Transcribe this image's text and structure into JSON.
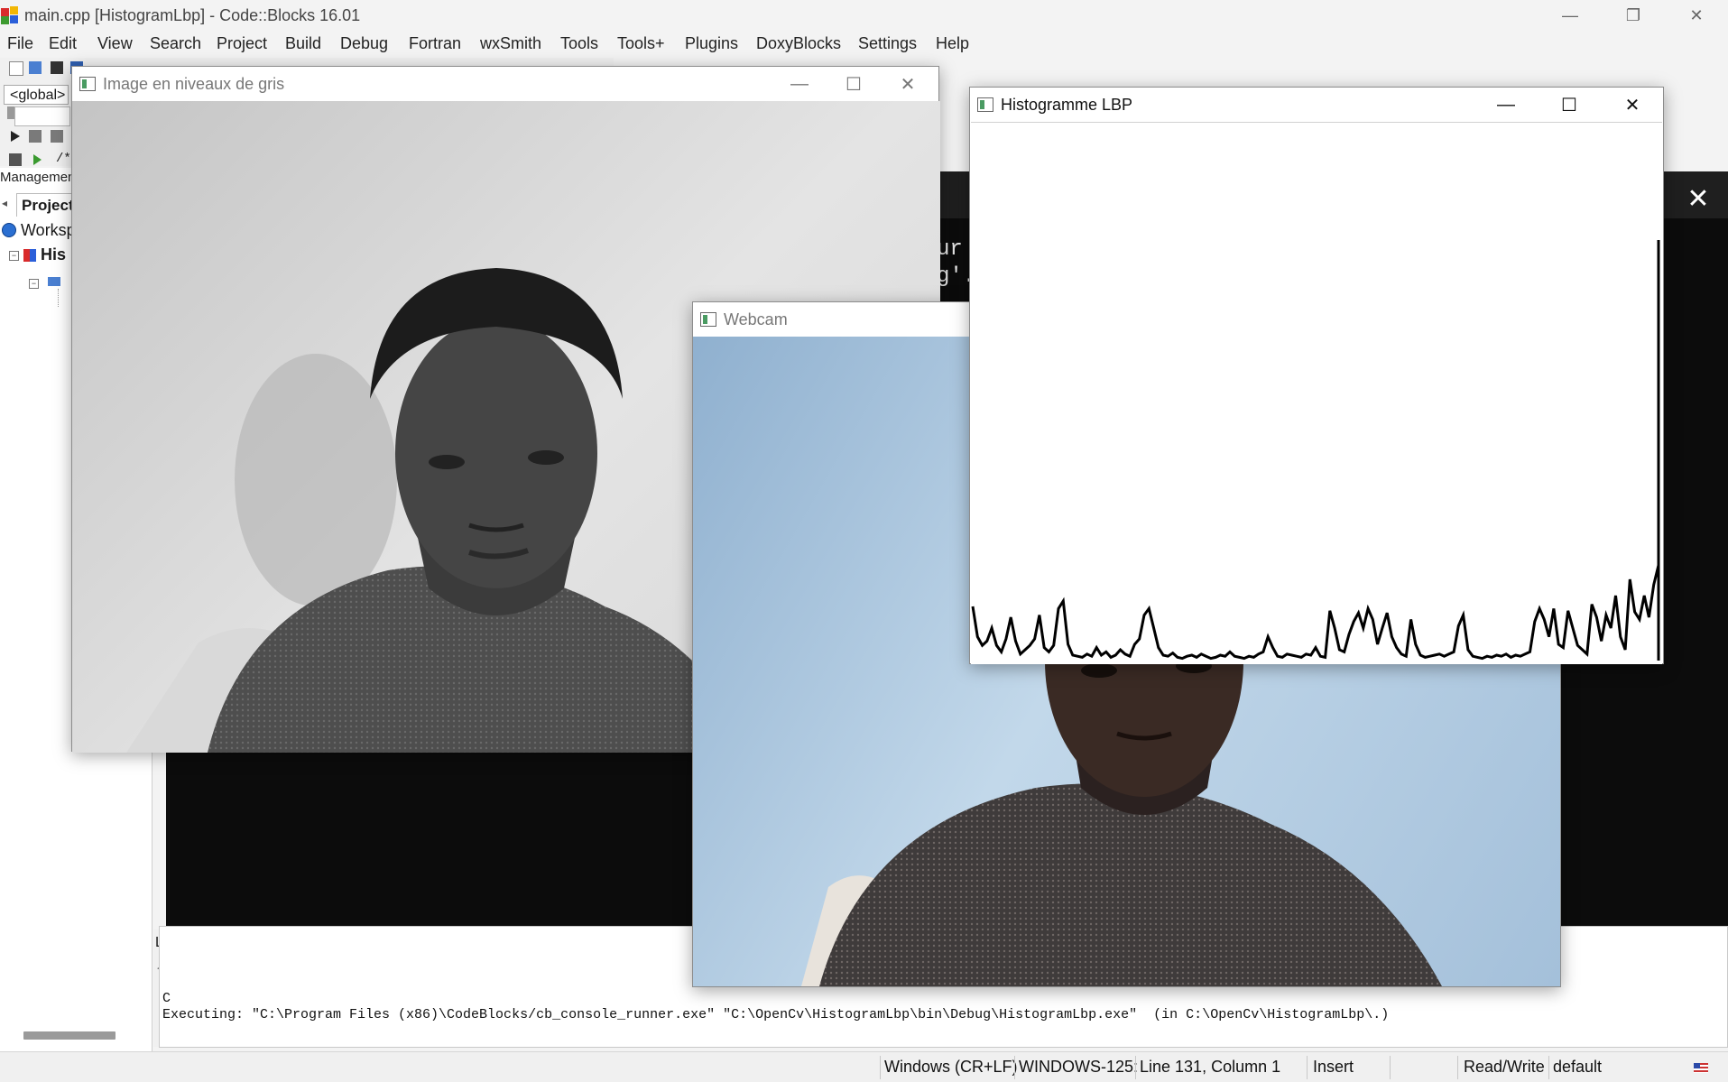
{
  "window": {
    "title": "main.cpp [HistogramLbp] - Code::Blocks 16.01",
    "controls": {
      "minimize": "—",
      "restore": "❐",
      "close": "✕"
    }
  },
  "menu": [
    "File",
    "Edit",
    "View",
    "Search",
    "Project",
    "Build",
    "Debug",
    "Fortran",
    "wxSmith",
    "Tools",
    "Tools+",
    "Plugins",
    "DoxyBlocks",
    "Settings",
    "Help"
  ],
  "toolbar": {
    "scope_combo": "<global>",
    "comment_button": "/**"
  },
  "management": {
    "label": "Managemen",
    "tab": "Project",
    "workspace": "Worksp",
    "project": "His"
  },
  "log": {
    "partial_tab": "L",
    "partial_line": "C",
    "executing": "Executing: \"C:\\Program Files (x86)\\CodeBlocks/cb_console_runner.exe\" \"C:\\OpenCv\\HistogramLbp\\bin\\Debug\\HistogramLbp.exe\"  (in C:\\OpenCv\\HistogramLbp\\.)"
  },
  "console": {
    "text_line1": "ur",
    "text_line2": "g'.",
    "close": "✕"
  },
  "statusbar": {
    "line_endings": "Windows (CR+LF)",
    "encoding": "WINDOWS-125:",
    "position": "Line 131, Column 1",
    "mode": "Insert",
    "access": "Read/Write",
    "profile": "default"
  },
  "windows": {
    "gray": {
      "title": "Image en niveaux de gris"
    },
    "webcam": {
      "title": "Webcam"
    },
    "histogram": {
      "title": "Histogramme LBP"
    }
  },
  "histogram_data": {
    "values": [
      0.5,
      0.22,
      0.14,
      0.18,
      0.3,
      0.14,
      0.08,
      0.2,
      0.4,
      0.18,
      0.06,
      0.1,
      0.14,
      0.2,
      0.42,
      0.12,
      0.08,
      0.14,
      0.48,
      0.55,
      0.15,
      0.05,
      0.04,
      0.03,
      0.06,
      0.04,
      0.12,
      0.05,
      0.08,
      0.03,
      0.05,
      0.1,
      0.06,
      0.04,
      0.15,
      0.2,
      0.42,
      0.48,
      0.3,
      0.12,
      0.05,
      0.04,
      0.07,
      0.03,
      0.02,
      0.04,
      0.05,
      0.03,
      0.06,
      0.04,
      0.02,
      0.03,
      0.05,
      0.04,
      0.08,
      0.04,
      0.03,
      0.02,
      0.04,
      0.03,
      0.06,
      0.08,
      0.22,
      0.12,
      0.04,
      0.03,
      0.06,
      0.05,
      0.04,
      0.03,
      0.06,
      0.05,
      0.12,
      0.04,
      0.03,
      0.46,
      0.3,
      0.1,
      0.08,
      0.24,
      0.36,
      0.44,
      0.3,
      0.48,
      0.38,
      0.15,
      0.3,
      0.44,
      0.22,
      0.12,
      0.06,
      0.04,
      0.38,
      0.15,
      0.05,
      0.03,
      0.04,
      0.05,
      0.06,
      0.04,
      0.06,
      0.08,
      0.32,
      0.42,
      0.1,
      0.04,
      0.03,
      0.02,
      0.04,
      0.03,
      0.05,
      0.04,
      0.06,
      0.03,
      0.05,
      0.04,
      0.06,
      0.08,
      0.36,
      0.48,
      0.38,
      0.22,
      0.48,
      0.15,
      0.12,
      0.46,
      0.3,
      0.14,
      0.1,
      0.06,
      0.52,
      0.4,
      0.18,
      0.42,
      0.3,
      0.6,
      0.22,
      0.1,
      0.75,
      0.45,
      0.38,
      0.6,
      0.4,
      0.7,
      0.88
    ]
  }
}
